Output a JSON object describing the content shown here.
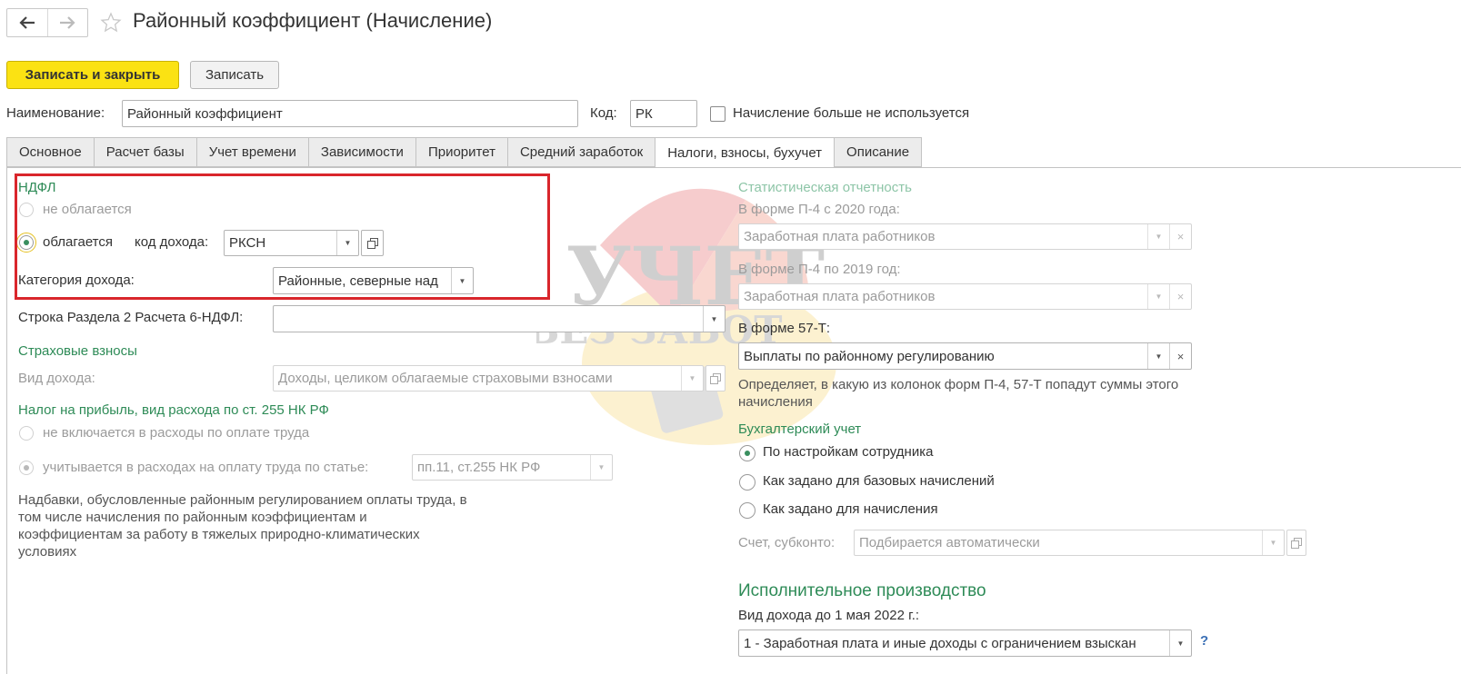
{
  "header": {
    "title": "Районный коэффициент (Начисление)",
    "back_icon": "arrow-left-icon",
    "forward_icon": "arrow-right-icon",
    "favorite_icon": "star-icon"
  },
  "toolbar": {
    "save_close_label": "Записать и закрыть",
    "save_label": "Записать"
  },
  "form": {
    "name_label": "Наименование:",
    "name_value": "Районный коэффициент",
    "code_label": "Код:",
    "code_value": "РК",
    "unused_label": "Начисление больше не используется"
  },
  "tabs": [
    {
      "label": "Основное"
    },
    {
      "label": "Расчет базы"
    },
    {
      "label": "Учет времени"
    },
    {
      "label": "Зависимости"
    },
    {
      "label": "Приоритет"
    },
    {
      "label": "Средний заработок"
    },
    {
      "label": "Налоги, взносы, бухучет"
    },
    {
      "label": "Описание"
    }
  ],
  "ndfl": {
    "section_title": "НДФЛ",
    "not_taxed_label": "не облагается",
    "taxed_label": "облагается",
    "income_code_label": "код дохода:",
    "income_code_value": "РКСН",
    "income_category_label": "Категория дохода:",
    "income_category_value": "Районные, северные над",
    "row_6ndfl_label": "Строка Раздела 2 Расчета 6-НДФЛ:",
    "row_6ndfl_value": ""
  },
  "insurance": {
    "section_title": "Страховые взносы",
    "income_type_label": "Вид дохода:",
    "income_type_value": "Доходы, целиком облагаемые страховыми взносами"
  },
  "profit_tax": {
    "section_title": "Налог на прибыль, вид расхода по ст. 255 НК РФ",
    "not_included_label": "не включается в расходы по оплате труда",
    "included_label": "учитывается в расходах на оплату труда по статье:",
    "article_value": "пп.11, ст.255 НК РФ",
    "description": "Надбавки, обусловленные районным регулированием оплаты труда, в том числе начисления по районным коэффициентам и коэффициентам за работу в тяжелых природно-климатических условиях"
  },
  "statistics": {
    "section_title": "Статистическая отчетность",
    "p4_2020_label": "В форме П-4 с 2020 года:",
    "p4_2020_value": "Заработная плата работников",
    "p4_2019_label": "В форме П-4 по 2019 год:",
    "p4_2019_value": "Заработная плата работников",
    "f57t_label": "В форме 57-Т:",
    "f57t_value": "Выплаты по районному регулированию",
    "hint": "Определяет, в какую из колонок форм П-4, 57-Т попадут суммы этого начисления"
  },
  "accounting": {
    "section_title": "Бухгалтерский учет",
    "by_employee_label": "По настройкам сотрудника",
    "as_base_label": "Как задано для базовых начислений",
    "as_accrual_label": "Как задано для начисления",
    "account_label": "Счет, субконто:",
    "account_value": "Подбирается автоматически"
  },
  "enforcement": {
    "section_title": "Исполнительное производство",
    "income_type_label": "Вид дохода до 1 мая 2022 г.:",
    "income_type_value": "1 - Заработная плата и иные доходы с ограничением взыскан",
    "help_label": "?"
  },
  "watermark": {
    "line1": "УЧЕТ",
    "line2": "БЕЗ ЗАБОТ"
  },
  "colors": {
    "accent_green": "#2e8b57",
    "primary_button": "#fbe213",
    "highlight_red": "#d9262c"
  }
}
